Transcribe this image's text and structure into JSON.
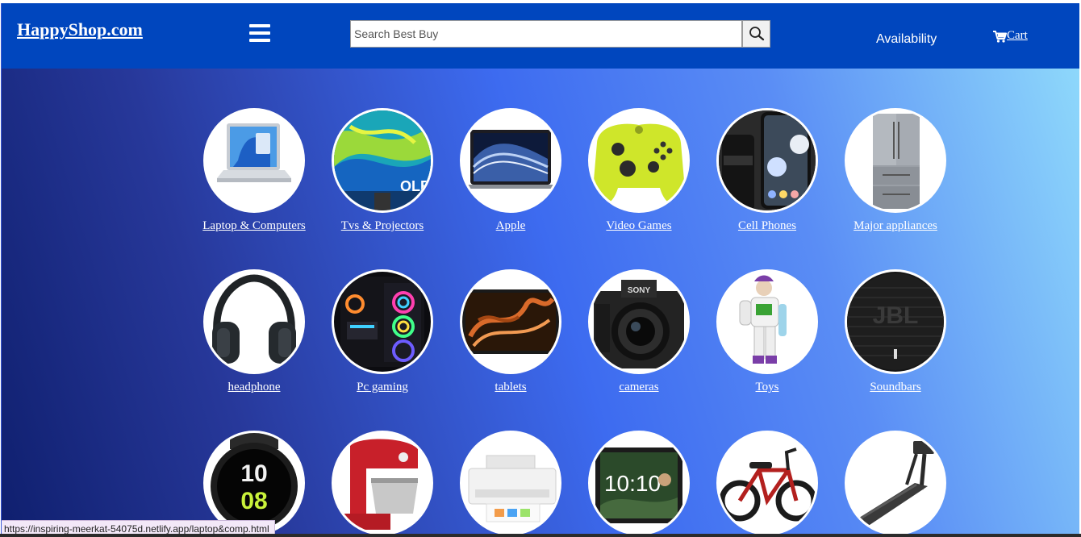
{
  "header": {
    "brand": "HappyShop.com",
    "search_placeholder": "Search Best Buy",
    "availability": "Availability",
    "cart_label": "Cart"
  },
  "categories": [
    {
      "label": "Laptop & Computers",
      "icon": "laptop-icon"
    },
    {
      "label": "Tvs & Projectors",
      "icon": "tv-icon"
    },
    {
      "label": "Apple",
      "icon": "macbook-icon"
    },
    {
      "label": "Video Games",
      "icon": "game-controller-icon"
    },
    {
      "label": "Cell Phones",
      "icon": "cell-phone-icon"
    },
    {
      "label": "Major appliances",
      "icon": "refrigerator-icon"
    },
    {
      "label": "headphone",
      "icon": "headphone-icon"
    },
    {
      "label": "Pc gaming",
      "icon": "gaming-pc-icon"
    },
    {
      "label": "tablets",
      "icon": "tablet-icon"
    },
    {
      "label": "cameras",
      "icon": "camera-icon"
    },
    {
      "label": "Toys",
      "icon": "toy-icon"
    },
    {
      "label": "Soundbars",
      "icon": "speaker-icon"
    },
    {
      "label": "",
      "icon": "smartwatch-icon"
    },
    {
      "label": "",
      "icon": "stand-mixer-icon"
    },
    {
      "label": "",
      "icon": "printer-icon"
    },
    {
      "label": "",
      "icon": "smart-display-icon"
    },
    {
      "label": "",
      "icon": "e-bike-icon"
    },
    {
      "label": "",
      "icon": "treadmill-icon"
    }
  ],
  "smartwatch_time_hours": "10",
  "smartwatch_time_minutes": "08",
  "smart_display_time": "10:10",
  "tv_brand_text": "OLED",
  "speaker_brand_text": "JBL",
  "camera_brand_text": "SONY",
  "status_url": "https://inspiring-meerkat-54075d.netlify.app/laptop&comp.html",
  "colors": {
    "navbar": "#0046be",
    "text": "#ffffff",
    "gradient_start": "#0f1f6e",
    "gradient_mid": "#3d6bf0",
    "gradient_end": "#8ed8fb"
  }
}
